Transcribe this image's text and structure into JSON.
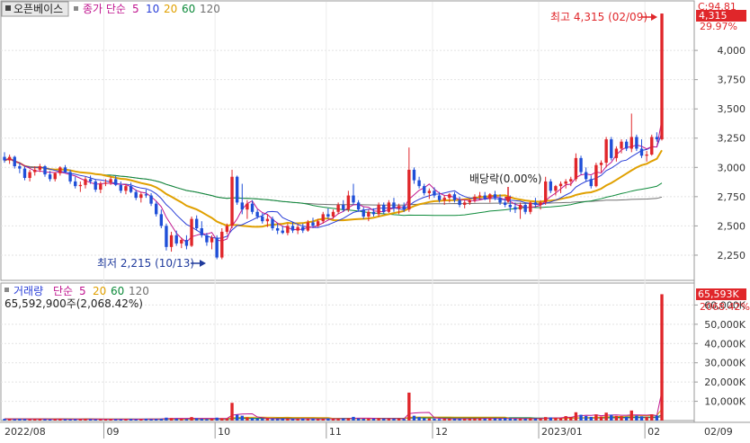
{
  "price_panel": {
    "stock_name": "오픈베이스",
    "ma_label": "종가 단순",
    "ma_periods": [
      "5",
      "10",
      "20",
      "60",
      "120"
    ],
    "ma_colors": [
      "#c0158f",
      "#2a3fd8",
      "#e0a000",
      "#0d8a3a",
      "#707070"
    ],
    "last_price_badge": "4,315",
    "change_label": "C:94.81",
    "change_pct": "29.97%",
    "high_annotation": "최고 4,315 (02/09)",
    "low_annotation": "최저 2,215 (10/13)",
    "dividend_annotation": "배당락(0.00%)"
  },
  "volume_panel": {
    "title": "거래량",
    "ma_label": "단순",
    "ma_periods": [
      "5",
      "20",
      "60",
      "120"
    ],
    "ma_colors": [
      "#c0158f",
      "#e0a000",
      "#0d8a3a",
      "#707070"
    ],
    "volume_text": "65,592,900주(2,068.42%)",
    "last_volume_badge": "65,593K",
    "volume_pct": "2068.42%"
  },
  "x_axis": {
    "labels": [
      "2022/08",
      "09",
      "10",
      "11",
      "12",
      "2023/01",
      "02",
      "02/09"
    ]
  },
  "chart_data": [
    {
      "type": "candlestick",
      "title": "오픈베이스",
      "y_ticks": [
        "4,000",
        "3,750",
        "3,500",
        "3,250",
        "3,000",
        "2,750",
        "2,500",
        "2,250"
      ],
      "ylim": [
        2050,
        4400
      ],
      "up_color": "#e0262a",
      "down_color": "#1f4fd8",
      "candles": [
        [
          3090,
          3130,
          3040,
          3060
        ],
        [
          3060,
          3110,
          3030,
          3090
        ],
        [
          3090,
          3100,
          2990,
          3010
        ],
        [
          3010,
          3040,
          2950,
          2990
        ],
        [
          2990,
          3010,
          2890,
          2910
        ],
        [
          2910,
          2980,
          2880,
          2960
        ],
        [
          2960,
          3010,
          2930,
          2980
        ],
        [
          2980,
          3030,
          2960,
          3010
        ],
        [
          3010,
          3020,
          2920,
          2940
        ],
        [
          2940,
          2970,
          2880,
          2900
        ],
        [
          2900,
          2960,
          2880,
          2950
        ],
        [
          2950,
          3010,
          2930,
          3000
        ],
        [
          3000,
          3020,
          2950,
          2960
        ],
        [
          2960,
          2980,
          2860,
          2880
        ],
        [
          2880,
          2920,
          2820,
          2840
        ],
        [
          2840,
          2880,
          2790,
          2850
        ],
        [
          2850,
          2920,
          2820,
          2900
        ],
        [
          2900,
          2930,
          2860,
          2880
        ],
        [
          2880,
          2900,
          2790,
          2810
        ],
        [
          2810,
          2880,
          2780,
          2860
        ],
        [
          2860,
          2900,
          2840,
          2870
        ],
        [
          2870,
          2920,
          2850,
          2900
        ],
        [
          2900,
          2930,
          2840,
          2850
        ],
        [
          2850,
          2880,
          2780,
          2800
        ],
        [
          2800,
          2860,
          2770,
          2840
        ],
        [
          2840,
          2870,
          2780,
          2790
        ],
        [
          2790,
          2810,
          2720,
          2740
        ],
        [
          2740,
          2790,
          2700,
          2770
        ],
        [
          2770,
          2810,
          2740,
          2760
        ],
        [
          2760,
          2780,
          2670,
          2690
        ],
        [
          2690,
          2710,
          2580,
          2600
        ],
        [
          2600,
          2640,
          2480,
          2500
        ],
        [
          2500,
          2520,
          2290,
          2320
        ],
        [
          2320,
          2450,
          2280,
          2420
        ],
        [
          2420,
          2460,
          2330,
          2350
        ],
        [
          2350,
          2400,
          2310,
          2380
        ],
        [
          2380,
          2420,
          2300,
          2330
        ],
        [
          2330,
          2580,
          2320,
          2560
        ],
        [
          2560,
          2590,
          2460,
          2480
        ],
        [
          2480,
          2540,
          2400,
          2420
        ],
        [
          2420,
          2440,
          2330,
          2360
        ],
        [
          2360,
          2420,
          2300,
          2400
        ],
        [
          2400,
          2420,
          2215,
          2230
        ],
        [
          2230,
          2480,
          2215,
          2450
        ],
        [
          2450,
          2520,
          2430,
          2500
        ],
        [
          2500,
          2980,
          2480,
          2920
        ],
        [
          2920,
          2930,
          2680,
          2700
        ],
        [
          2700,
          2860,
          2600,
          2640
        ],
        [
          2640,
          2720,
          2560,
          2690
        ],
        [
          2690,
          2720,
          2600,
          2620
        ],
        [
          2620,
          2640,
          2560,
          2580
        ],
        [
          2580,
          2610,
          2520,
          2540
        ],
        [
          2540,
          2600,
          2490,
          2560
        ],
        [
          2560,
          2580,
          2460,
          2480
        ],
        [
          2480,
          2520,
          2430,
          2460
        ],
        [
          2460,
          2500,
          2430,
          2440
        ],
        [
          2440,
          2520,
          2420,
          2500
        ],
        [
          2500,
          2530,
          2440,
          2460
        ],
        [
          2460,
          2510,
          2430,
          2490
        ],
        [
          2490,
          2520,
          2440,
          2460
        ],
        [
          2460,
          2550,
          2450,
          2530
        ],
        [
          2530,
          2570,
          2480,
          2500
        ],
        [
          2500,
          2560,
          2490,
          2540
        ],
        [
          2540,
          2620,
          2520,
          2600
        ],
        [
          2600,
          2650,
          2560,
          2580
        ],
        [
          2580,
          2640,
          2560,
          2620
        ],
        [
          2620,
          2700,
          2600,
          2680
        ],
        [
          2680,
          2720,
          2620,
          2640
        ],
        [
          2640,
          2800,
          2620,
          2760
        ],
        [
          2760,
          2860,
          2680,
          2700
        ],
        [
          2700,
          2720,
          2620,
          2640
        ],
        [
          2640,
          2660,
          2560,
          2580
        ],
        [
          2580,
          2640,
          2540,
          2620
        ],
        [
          2620,
          2650,
          2580,
          2600
        ],
        [
          2600,
          2700,
          2580,
          2680
        ],
        [
          2680,
          2700,
          2600,
          2620
        ],
        [
          2620,
          2720,
          2610,
          2700
        ],
        [
          2700,
          2740,
          2620,
          2650
        ],
        [
          2650,
          2690,
          2600,
          2670
        ],
        [
          2670,
          2700,
          2620,
          2640
        ],
        [
          2640,
          3170,
          2620,
          2980
        ],
        [
          2980,
          3000,
          2860,
          2890
        ],
        [
          2890,
          2920,
          2820,
          2840
        ],
        [
          2840,
          2860,
          2760,
          2780
        ],
        [
          2780,
          2820,
          2730,
          2800
        ],
        [
          2800,
          2830,
          2740,
          2760
        ],
        [
          2760,
          2790,
          2700,
          2720
        ],
        [
          2720,
          2760,
          2680,
          2740
        ],
        [
          2740,
          2780,
          2700,
          2770
        ],
        [
          2770,
          2790,
          2700,
          2720
        ],
        [
          2720,
          2750,
          2660,
          2680
        ],
        [
          2680,
          2720,
          2650,
          2700
        ],
        [
          2700,
          2730,
          2680,
          2720
        ],
        [
          2720,
          2770,
          2700,
          2750
        ],
        [
          2750,
          2790,
          2720,
          2760
        ],
        [
          2760,
          2790,
          2720,
          2730
        ],
        [
          2730,
          2780,
          2700,
          2770
        ],
        [
          2770,
          2800,
          2720,
          2740
        ],
        [
          2740,
          2770,
          2680,
          2700
        ],
        [
          2700,
          2740,
          2660,
          2680
        ],
        [
          2680,
          2760,
          2620,
          2660
        ],
        [
          2660,
          2700,
          2610,
          2640
        ],
        [
          2640,
          2700,
          2560,
          2680
        ],
        [
          2680,
          2700,
          2600,
          2620
        ],
        [
          2620,
          2710,
          2600,
          2700
        ],
        [
          2700,
          2740,
          2660,
          2680
        ],
        [
          2680,
          2720,
          2640,
          2700
        ],
        [
          2700,
          2920,
          2680,
          2880
        ],
        [
          2880,
          2900,
          2780,
          2800
        ],
        [
          2800,
          2850,
          2760,
          2840
        ],
        [
          2840,
          2880,
          2780,
          2860
        ],
        [
          2860,
          2900,
          2820,
          2880
        ],
        [
          2880,
          2920,
          2840,
          2900
        ],
        [
          2900,
          3120,
          2880,
          3080
        ],
        [
          3080,
          3100,
          2940,
          2960
        ],
        [
          2960,
          3000,
          2880,
          2900
        ],
        [
          2900,
          2930,
          2820,
          2840
        ],
        [
          2840,
          3040,
          2830,
          3020
        ],
        [
          3020,
          3060,
          2960,
          3040
        ],
        [
          3040,
          3260,
          3000,
          3240
        ],
        [
          3240,
          3260,
          3060,
          3080
        ],
        [
          3080,
          3180,
          3050,
          3160
        ],
        [
          3160,
          3240,
          3120,
          3220
        ],
        [
          3220,
          3240,
          3140,
          3160
        ],
        [
          3160,
          3460,
          3130,
          3260
        ],
        [
          3260,
          3280,
          3140,
          3160
        ],
        [
          3160,
          3240,
          3080,
          3100
        ],
        [
          3100,
          3140,
          3050,
          3110
        ],
        [
          3110,
          3280,
          3100,
          3260
        ],
        [
          3260,
          3300,
          3220,
          3240
        ],
        [
          3240,
          4315,
          3230,
          4315
        ]
      ]
    },
    {
      "type": "bar",
      "title": "거래량",
      "y_ticks": [
        "60,000K",
        "50,000K",
        "40,000K",
        "30,000K",
        "20,000K",
        "10,000K"
      ],
      "ylim": [
        0,
        70000
      ],
      "color": "#e0262a",
      "values": [
        900,
        800,
        700,
        900,
        800,
        700,
        800,
        900,
        700,
        600,
        800,
        900,
        700,
        600,
        700,
        800,
        900,
        700,
        600,
        700,
        600,
        800,
        700,
        600,
        700,
        800,
        600,
        700,
        900,
        700,
        800,
        900,
        1500,
        1300,
        1000,
        900,
        800,
        1800,
        1200,
        900,
        800,
        900,
        1500,
        1200,
        1000,
        9200,
        3000,
        2500,
        1600,
        1200,
        1000,
        900,
        1100,
        800,
        700,
        900,
        1000,
        800,
        900,
        1000,
        800,
        900,
        700,
        900,
        1100,
        800,
        900,
        1000,
        1200,
        1900,
        1100,
        900,
        900,
        1000,
        1200,
        900,
        800,
        900,
        1000,
        800,
        14500,
        2500,
        1800,
        1200,
        1100,
        900,
        800,
        900,
        1000,
        900,
        800,
        900,
        1000,
        1100,
        1200,
        900,
        1000,
        1100,
        900,
        1300,
        1100,
        900,
        800,
        900,
        1200,
        1000,
        900,
        1800,
        1600,
        1400,
        1200,
        2300,
        1800,
        4300,
        3000,
        2400,
        1900,
        3200,
        2100,
        4100,
        3000,
        2400,
        2200,
        2000,
        5200,
        2600,
        2200,
        2000,
        3200,
        2600,
        65593
      ]
    }
  ]
}
